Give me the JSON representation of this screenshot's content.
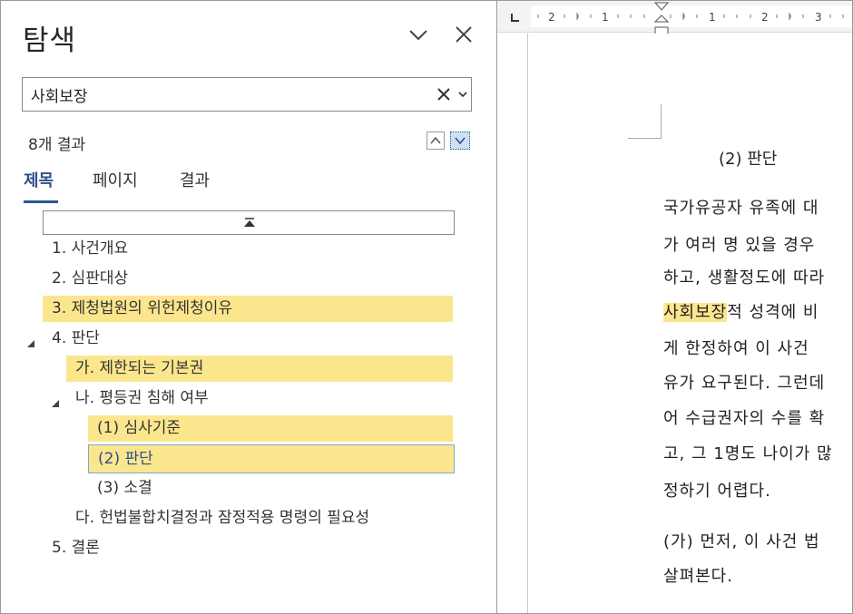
{
  "nav_pane": {
    "title": "탐색",
    "search": {
      "value": "사회보장",
      "placeholder": ""
    },
    "result_count": "8개 결과",
    "tabs": [
      {
        "label": "제목",
        "active": true
      },
      {
        "label": "페이지",
        "active": false
      },
      {
        "label": "결과",
        "active": false
      }
    ],
    "headings": [
      {
        "label": "1. 사건개요",
        "level": 1,
        "highlighted": false,
        "selected": false
      },
      {
        "label": "2. 심판대상",
        "level": 1,
        "highlighted": false,
        "selected": false
      },
      {
        "label": "3. 제청법원의 위헌제청이유",
        "level": 1,
        "highlighted": true,
        "selected": false
      },
      {
        "label": "4. 판단",
        "level": 1,
        "highlighted": false,
        "selected": false,
        "expanded": true
      },
      {
        "label": "가. 제한되는 기본권",
        "level": 2,
        "highlighted": true,
        "selected": false
      },
      {
        "label": "나. 평등권 침해 여부",
        "level": 2,
        "highlighted": false,
        "selected": false,
        "expanded": true
      },
      {
        "label": "(1) 심사기준",
        "level": 3,
        "highlighted": true,
        "selected": false
      },
      {
        "label": "(2) 판단",
        "level": 3,
        "highlighted": true,
        "selected": true
      },
      {
        "label": "(3) 소결",
        "level": 3,
        "highlighted": false,
        "selected": false
      },
      {
        "label": "다. 헌법불합치결정과 잠정적용 명령의 필요성",
        "level": 2,
        "highlighted": false,
        "selected": false
      },
      {
        "label": "5. 결론",
        "level": 1,
        "highlighted": false,
        "selected": false
      }
    ]
  },
  "ruler": {
    "labels": [
      "2",
      "1",
      "1",
      "2",
      "3"
    ]
  },
  "document": {
    "heading": "(2) 판단",
    "lines": [
      {
        "before": "국가유공자 유족에 대",
        "mark": "",
        "after": ""
      },
      {
        "before": "가 여러 명 있을 경우",
        "mark": "",
        "after": ""
      },
      {
        "before": "하고, 생활정도에 따라",
        "mark": "",
        "after": ""
      },
      {
        "before": "",
        "mark": "사회보장",
        "after": "적 성격에 비"
      },
      {
        "before": "게 한정하여 이 사건 ",
        "mark": "",
        "after": ""
      },
      {
        "before": "유가 요구된다. 그런데",
        "mark": "",
        "after": ""
      },
      {
        "before": "어 수급권자의 수를 확",
        "mark": "",
        "after": ""
      },
      {
        "before": "고, 그 1명도 나이가 많",
        "mark": "",
        "after": ""
      },
      {
        "before": "정하기 어렵다.",
        "mark": "",
        "after": ""
      },
      {
        "before": "(가) 먼저, 이 사건 법",
        "mark": "",
        "after": ""
      },
      {
        "before": "살펴본다.",
        "mark": "",
        "after": ""
      }
    ]
  },
  "colors": {
    "highlight": "#fce68d",
    "accent": "#2b579a",
    "selected_border": "#7aa8d8"
  }
}
